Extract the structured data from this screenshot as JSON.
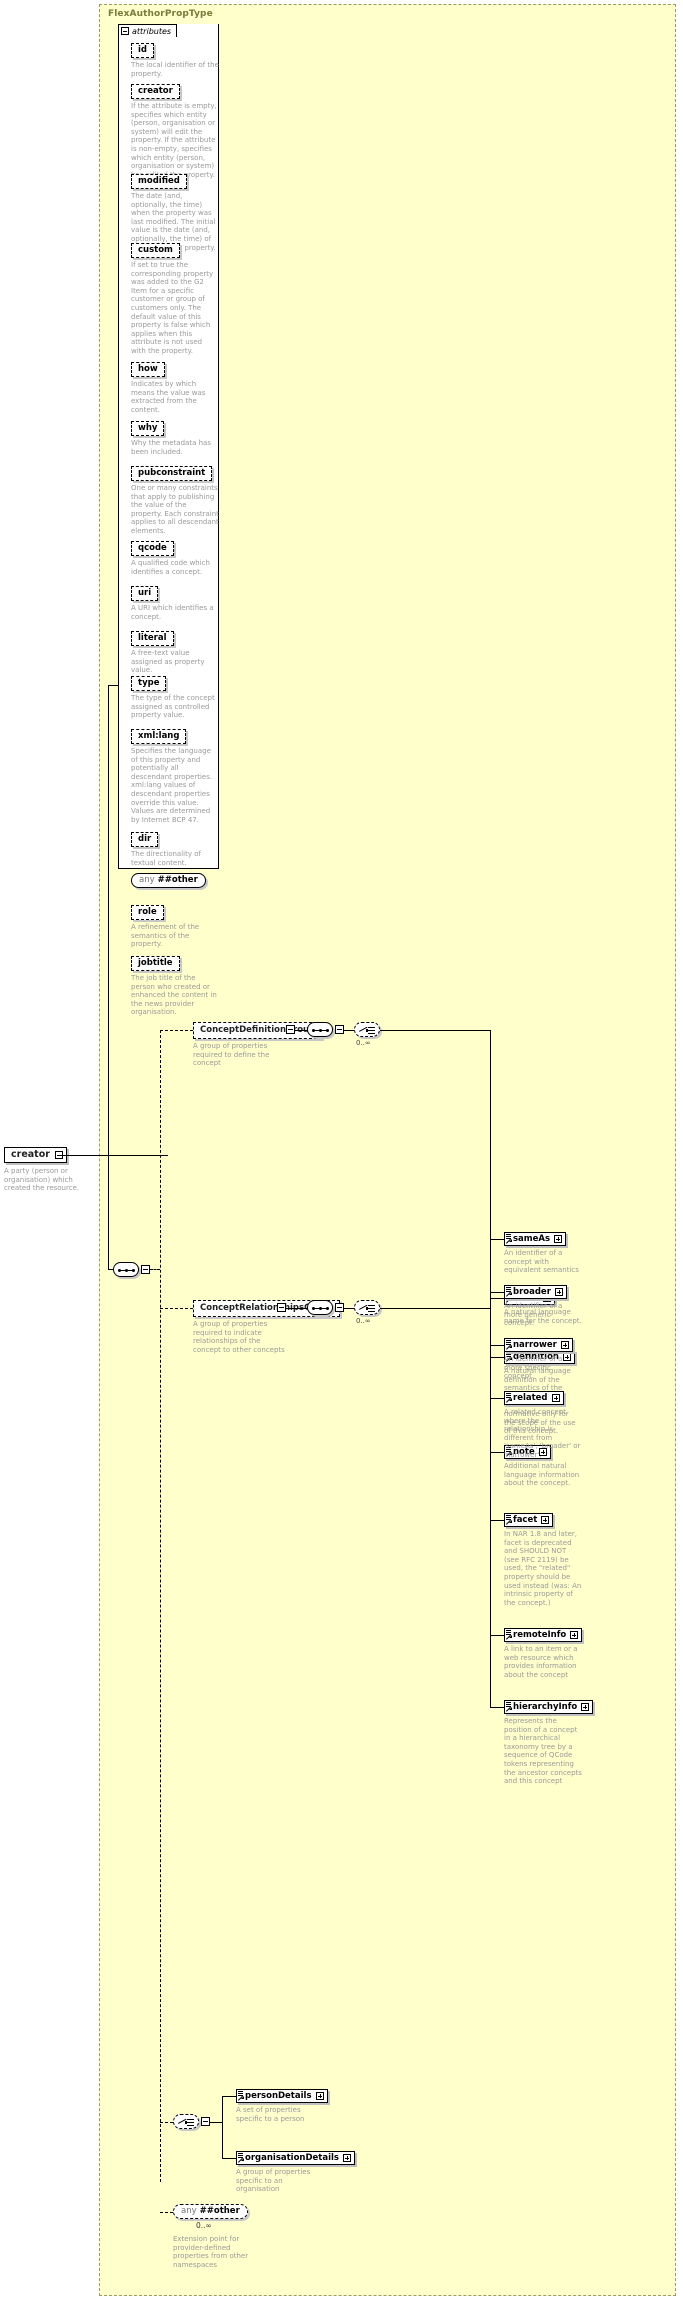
{
  "type": {
    "name": "FlexAuthorPropType",
    "attributes_label": "attributes"
  },
  "root_element": {
    "name": "creator",
    "doc": "A party (person or organisation) which created the resource."
  },
  "attributes": [
    {
      "name": "id",
      "doc": "The local identifier of the property."
    },
    {
      "name": "creator",
      "doc": "If the attribute is empty, specifies which entity (person, organisation or system) will edit the property. If the attribute is non-empty, specifies which entity (person, organisation or system) has edited the property."
    },
    {
      "name": "modified",
      "doc": "The date (and, optionally, the time) when the property was last modified. The initial value is the date (and, optionally, the time) of creation of the property."
    },
    {
      "name": "custom",
      "doc": "If set to true the corresponding property was added to the G2 Item for a specific customer or group of customers only. The default value of this property is false which applies when this attribute is not used with the property."
    },
    {
      "name": "how",
      "doc": "Indicates by which means the value was extracted from the content."
    },
    {
      "name": "why",
      "doc": "Why the metadata has been included."
    },
    {
      "name": "pubconstraint",
      "doc": "One or many constraints that apply to publishing the value of the property. Each constraint applies to all descendant elements."
    },
    {
      "name": "qcode",
      "doc": "A qualified code which identifies a concept."
    },
    {
      "name": "uri",
      "doc": "A URI which identifies a concept."
    },
    {
      "name": "literal",
      "doc": "A free-text value assigned as property value."
    },
    {
      "name": "type",
      "doc": "The type of the concept assigned as controlled property value."
    },
    {
      "name": "xml:lang",
      "doc": "Specifies the language of this property and potentially all descendant properties. xml:lang values of descendant properties override this value. Values are determined by Internet BCP 47."
    },
    {
      "name": "dir",
      "doc": "The directionality of textual content."
    },
    {
      "name": "any ##other",
      "kind": "any",
      "any_keyword": "any",
      "any_value": "##other",
      "doc": ""
    },
    {
      "name": "role",
      "doc": "A refinement of the semantics of the property."
    },
    {
      "name": "jobtitle",
      "doc": "The job title of the person who created or enhanced the content in the news provider organisation."
    }
  ],
  "groups": {
    "concept_definition": {
      "label": "ConceptDefinitionGroup",
      "doc": "A group of properties required to define the concept",
      "cardinality": "0..∞",
      "elements": [
        {
          "name": "name",
          "doc": "A natural language name for the concept."
        },
        {
          "name": "definition",
          "doc": "A natural language definition of the semantics of the concept. This definition is normative only for the scope of the use of this concept."
        },
        {
          "name": "note",
          "doc": "Additional natural language information about the concept."
        },
        {
          "name": "facet",
          "doc": "In NAR 1.8 and later, facet is deprecated and SHOULD NOT (see RFC 2119) be used, the \"related\" property should be used instead (was: An intrinsic property of the concept.)"
        },
        {
          "name": "remoteInfo",
          "doc": "A link to an item or a web resource which provides information about the concept"
        },
        {
          "name": "hierarchyInfo",
          "doc": "Represents the position of a concept in a hierarchical taxonomy tree by a sequence of QCode tokens representing the ancestor concepts and this concept"
        }
      ]
    },
    "concept_relationships": {
      "label": "ConceptRelationshipsGroup",
      "doc": "A group of properties required to indicate relationships of the concept to other concepts",
      "cardinality": "0..∞",
      "elements": [
        {
          "name": "sameAs",
          "doc": "An identifier of a concept with equivalent semantics"
        },
        {
          "name": "broader",
          "doc": "An identifier of a more generic concept."
        },
        {
          "name": "narrower",
          "doc": "An identifier of a more specific concept."
        },
        {
          "name": "related",
          "doc": "A related concept, where the relationship is different from 'sameAs', 'broader' or 'narrower'."
        }
      ]
    },
    "details_choice": {
      "elements": [
        {
          "name": "personDetails",
          "doc": "A set of properties specific to a person"
        },
        {
          "name": "organisationDetails",
          "doc": "A group of properties specific to an organisation"
        }
      ]
    }
  },
  "any_other": {
    "keyword": "any",
    "value": "##other",
    "cardinality": "0..∞",
    "doc": "Extension point for provider-defined properties from other namespaces"
  },
  "colors": {
    "type_background": "#ffffcc",
    "type_border": "#9a9a6a",
    "type_title": "#7a7a3a",
    "doc_text": "#9a9a9a",
    "node_shadow": "#c8c8c8"
  }
}
